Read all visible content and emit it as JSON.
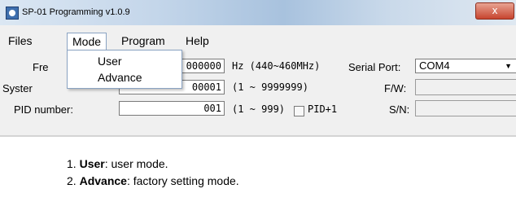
{
  "window": {
    "title": "SP-01 Programming v1.0.9",
    "close_label": "x"
  },
  "menu": {
    "items": [
      "Files",
      "Mode",
      "Program",
      "Help"
    ],
    "open_menu": "Mode",
    "mode_dropdown": [
      "User",
      "Advance"
    ]
  },
  "form": {
    "freq_label_visible": "Fre",
    "freq_value_visible": "000000",
    "freq_unit": "Hz (440~460MHz)",
    "system_label_visible": "Syster",
    "system_value_visible": "00001",
    "system_range": "(1 ~ 9999999)",
    "pid_label": "PID number:",
    "pid_value": "001",
    "pid_range": "(1 ~ 999)",
    "pid_plus_label": "PID+1",
    "pid_plus_checked": false,
    "serial_port_label": "Serial Port:",
    "serial_port_value": "COM4",
    "fw_label": "F/W:",
    "sn_label": "S/N:"
  },
  "doc": {
    "items": [
      {
        "num": "1.",
        "term": "User",
        "desc": ": user mode."
      },
      {
        "num": "2.",
        "term": "Advance",
        "desc": ": factory setting mode."
      }
    ]
  }
}
